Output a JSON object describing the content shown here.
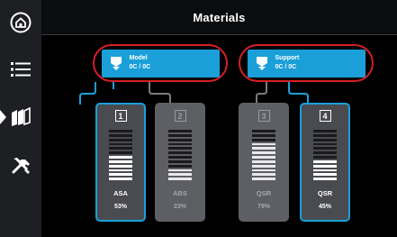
{
  "header": {
    "title": "Materials"
  },
  "sidebar": {
    "items": [
      {
        "icon": "home-icon"
      },
      {
        "icon": "list-icon"
      },
      {
        "icon": "materials-icon",
        "active": true
      },
      {
        "icon": "tools-icon"
      }
    ]
  },
  "spools": [
    {
      "label": "Model",
      "value": "0C / 0C"
    },
    {
      "label": "Support",
      "value": "0C / 0C"
    }
  ],
  "bays": [
    {
      "number": "1",
      "material": "ASA",
      "percent": "53%",
      "level": 0.53,
      "active": true
    },
    {
      "number": "2",
      "material": "ABS",
      "percent": "23%",
      "level": 0.23,
      "active": false
    },
    {
      "number": "3",
      "material": "QSR",
      "percent": "79%",
      "level": 0.79,
      "active": false
    },
    {
      "number": "4",
      "material": "QSR",
      "percent": "45%",
      "level": 0.45,
      "active": true
    }
  ],
  "colors": {
    "accent": "#1a9fd9",
    "highlight": "#d61f26"
  }
}
